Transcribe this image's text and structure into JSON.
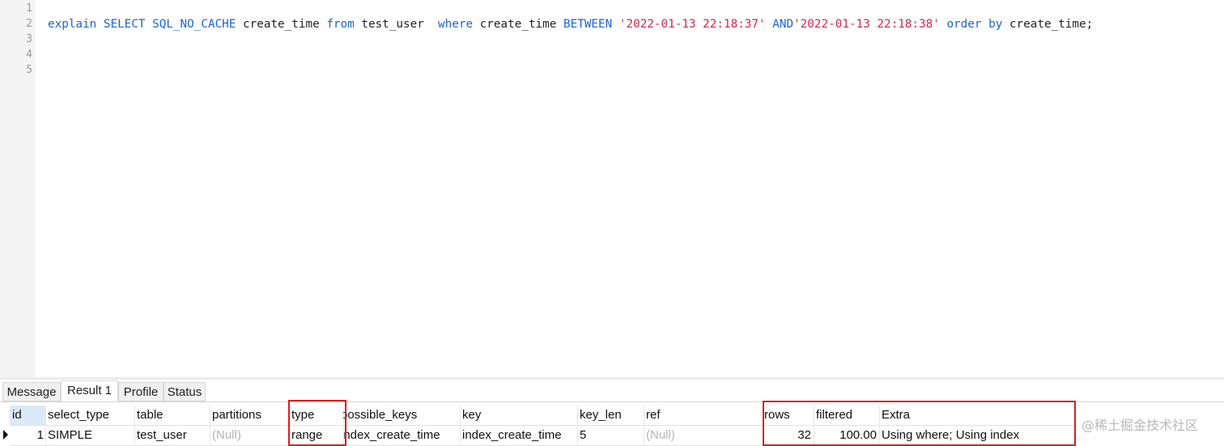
{
  "editor": {
    "line_numbers": [
      "1",
      "2",
      "3",
      "4",
      "5"
    ],
    "query_tokens": [
      {
        "text": "explain SELECT SQL_NO_CACHE",
        "class": "kw"
      },
      {
        "text": " create_time ",
        "class": ""
      },
      {
        "text": "from",
        "class": "kw"
      },
      {
        "text": " test_user  ",
        "class": ""
      },
      {
        "text": "where",
        "class": "kw"
      },
      {
        "text": " create_time ",
        "class": ""
      },
      {
        "text": "BETWEEN",
        "class": "kw"
      },
      {
        "text": " ",
        "class": ""
      },
      {
        "text": "'2022-01-13 22:18:37'",
        "class": "str"
      },
      {
        "text": " ",
        "class": ""
      },
      {
        "text": "AND",
        "class": "kw"
      },
      {
        "text": "'2022-01-13 22:18:38'",
        "class": "str"
      },
      {
        "text": " ",
        "class": ""
      },
      {
        "text": "order by",
        "class": "kw"
      },
      {
        "text": " create_time;",
        "class": ""
      }
    ]
  },
  "tabs": {
    "message": "Message",
    "result1": "Result 1",
    "profile": "Profile",
    "status": "Status"
  },
  "grid": {
    "headers": {
      "id": "id",
      "select_type": "select_type",
      "table": "table",
      "partitions": "partitions",
      "type": "type",
      "possible_keys": "possible_keys",
      "key": "key",
      "key_len": "key_len",
      "ref": "ref",
      "rows": "rows",
      "filtered": "filtered",
      "extra": "Extra"
    },
    "row": {
      "id": "1",
      "select_type": "SIMPLE",
      "table": "test_user",
      "partitions": "(Null)",
      "type": "range",
      "possible_keys": "index_create_time",
      "key": "index_create_time",
      "key_len": "5",
      "ref": "(Null)",
      "rows": "32",
      "filtered": "100.00",
      "extra": "Using where; Using index"
    }
  },
  "watermark": "@稀土掘金技术社区",
  "colors": {
    "keyword": "#1e63d6",
    "string": "#d7264f",
    "highlight_box": "#d62020",
    "null_text": "#b5b5b5"
  }
}
